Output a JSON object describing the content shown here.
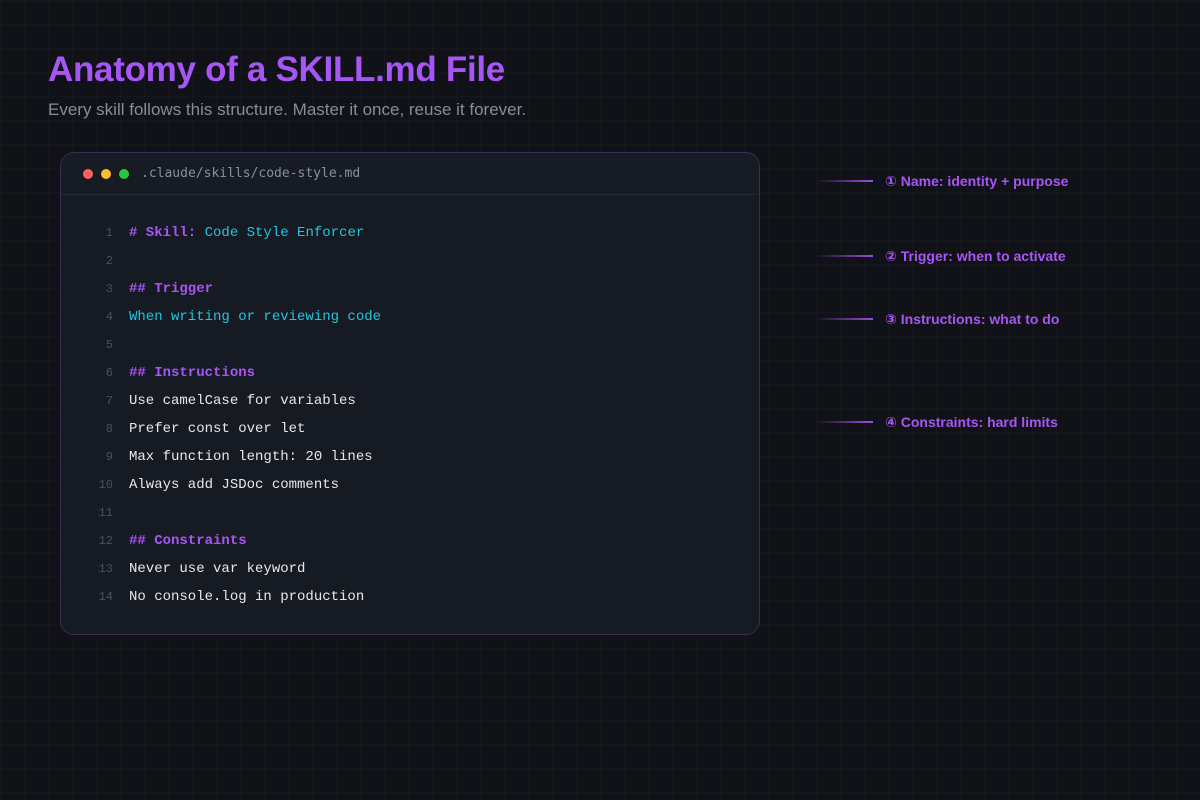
{
  "page": {
    "title": "Anatomy of a SKILL.md File",
    "subtitle": "Every skill follows this structure. Master it once, reuse it forever."
  },
  "editor": {
    "filename": ".claude/skills/code-style.md",
    "lines": [
      {
        "n": "1",
        "parts": [
          {
            "t": "# Skill: ",
            "c": "heading"
          },
          {
            "t": "Code Style Enforcer",
            "c": "accent"
          }
        ]
      },
      {
        "n": "2",
        "parts": []
      },
      {
        "n": "3",
        "parts": [
          {
            "t": "## Trigger",
            "c": "heading"
          }
        ]
      },
      {
        "n": "4",
        "parts": [
          {
            "t": "When writing or reviewing code",
            "c": "accent"
          }
        ]
      },
      {
        "n": "5",
        "parts": []
      },
      {
        "n": "6",
        "parts": [
          {
            "t": "## Instructions",
            "c": "heading"
          }
        ]
      },
      {
        "n": "7",
        "parts": [
          {
            "t": "Use camelCase for variables",
            "c": "plain"
          }
        ]
      },
      {
        "n": "8",
        "parts": [
          {
            "t": "Prefer const over let",
            "c": "plain"
          }
        ]
      },
      {
        "n": "9",
        "parts": [
          {
            "t": "Max function length: 20 lines",
            "c": "plain"
          }
        ]
      },
      {
        "n": "10",
        "parts": [
          {
            "t": "Always add JSDoc comments",
            "c": "plain"
          }
        ]
      },
      {
        "n": "11",
        "parts": []
      },
      {
        "n": "12",
        "parts": [
          {
            "t": "## Constraints",
            "c": "heading"
          }
        ]
      },
      {
        "n": "13",
        "parts": [
          {
            "t": "Never use var keyword",
            "c": "plain"
          }
        ]
      },
      {
        "n": "14",
        "parts": [
          {
            "t": "No console.log in production",
            "c": "plain"
          }
        ]
      }
    ]
  },
  "annotations": [
    {
      "label": "① Name: identity + purpose"
    },
    {
      "label": "② Trigger: when to activate"
    },
    {
      "label": "③ Instructions: what to do"
    },
    {
      "label": "④ Constraints: hard limits"
    }
  ],
  "colors": {
    "accent_purple": "#a855f7",
    "accent_cyan": "#22c5e0",
    "background": "#111217"
  }
}
